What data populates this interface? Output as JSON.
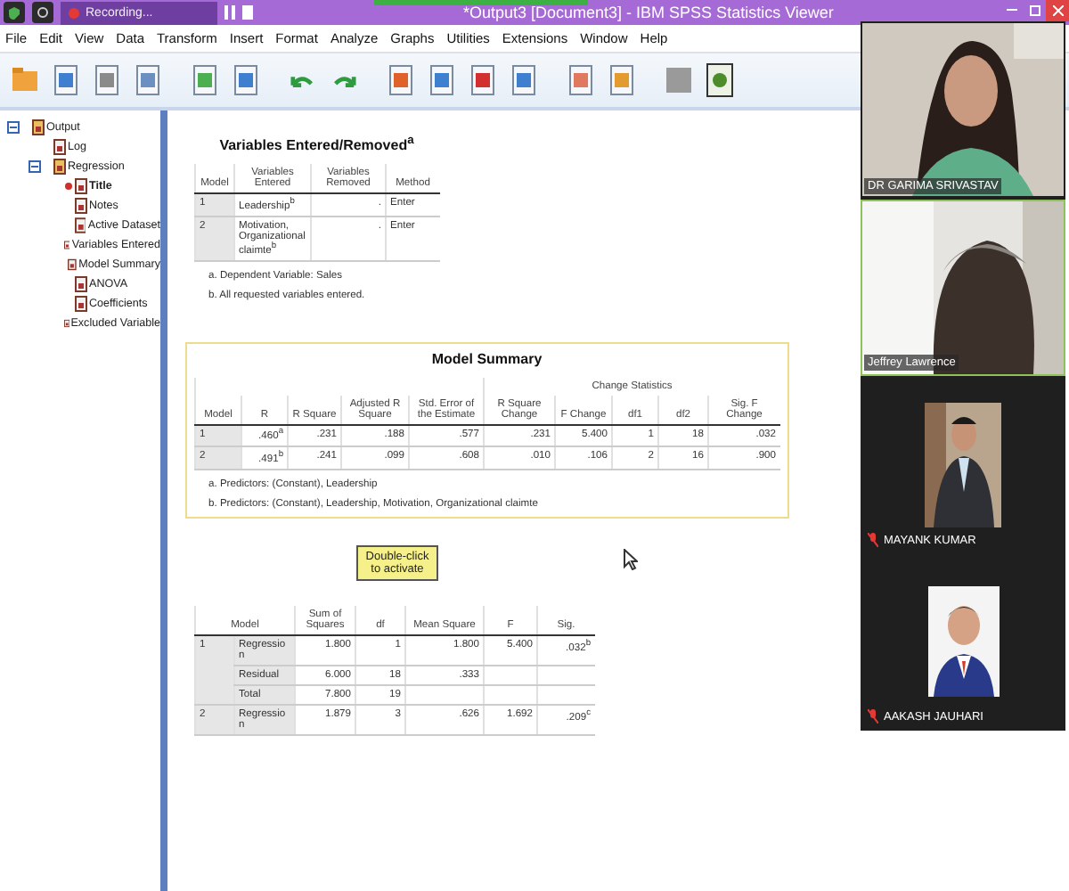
{
  "top_bar": {
    "recording_label": "Recording...",
    "title": "*Output3 [Document3] - IBM SPSS Statistics Viewer"
  },
  "menu": [
    {
      "label": "File"
    },
    {
      "label": "Edit"
    },
    {
      "label": "View"
    },
    {
      "label": "Data"
    },
    {
      "label": "Transform"
    },
    {
      "label": "Insert"
    },
    {
      "label": "Format"
    },
    {
      "label": "Analyze"
    },
    {
      "label": "Graphs"
    },
    {
      "label": "Utilities"
    },
    {
      "label": "Extensions"
    },
    {
      "label": "Window"
    },
    {
      "label": "Help"
    }
  ],
  "tree": [
    {
      "label": "Output",
      "selected": false,
      "expanded": true,
      "children": [
        {
          "label": "Log",
          "selected": false
        },
        {
          "label": "Regression",
          "selected": false,
          "expanded": true,
          "children": [
            {
              "label": "Title",
              "selected": true
            },
            {
              "label": "Notes",
              "selected": false
            },
            {
              "label": "Active Dataset",
              "selected": false
            },
            {
              "label": "Variables Entered",
              "selected": false
            },
            {
              "label": "Model Summary",
              "selected": false
            },
            {
              "label": "ANOVA",
              "selected": false
            },
            {
              "label": "Coefficients",
              "selected": false
            },
            {
              "label": "Excluded Variable",
              "selected": false
            }
          ]
        }
      ]
    }
  ],
  "variables_table": {
    "title": "Variables Entered/Removed$^{a}$",
    "columns": [
      "Model",
      "Variables Entered",
      "Variables Removed",
      "Method"
    ],
    "rows": [
      [
        "1",
        "Leadership$^{b}$",
        ".",
        "Enter"
      ],
      [
        "2",
        "Motivation, Organizational claimte$^{b}$",
        ".",
        "Enter"
      ]
    ],
    "footnotes": [
      "a. Dependent Variable: Sales",
      "b. All requested variables entered."
    ]
  },
  "model_summary": {
    "title": "Model Summary",
    "active": true,
    "group_header": "Change Statistics",
    "columns": [
      "Model",
      "R",
      "R Square",
      "Adjusted R Square",
      "Std. Error of the Estimate",
      "R Square Change",
      "F Change",
      "df1",
      "df2",
      "Sig. F Change"
    ],
    "rows": [
      [
        "1",
        ".460$^{a}$",
        ".231",
        ".188",
        ".577",
        ".231",
        "5.400",
        "1",
        "18",
        ".032"
      ],
      [
        "2",
        ".491$^{b}$",
        ".241",
        ".099",
        ".608",
        ".010",
        ".106",
        "2",
        "16",
        ".900"
      ]
    ],
    "footnotes": [
      "a. Predictors: (Constant), Leadership",
      "b. Predictors: (Constant), Leadership, Motivation, Organizational claimte"
    ]
  },
  "anova": {
    "tooltip": "Double-click to activate",
    "columns": [
      "Model",
      "Sum of Squares",
      "df",
      "Mean Square",
      "F",
      "Sig."
    ],
    "groups": [
      {
        "model": "1",
        "rows": [
          {
            "label": "Regression",
            "cells": [
              "1.800",
              "1",
              "1.800",
              "5.400",
              ".032$^{b}$"
            ]
          },
          {
            "label": "Residual",
            "cells": [
              "6.000",
              "18",
              ".333"
            ]
          },
          {
            "label": "Total",
            "cells": [
              "7.800",
              "19"
            ]
          }
        ]
      },
      {
        "model": "2",
        "rows": [
          {
            "label": "Regression",
            "cells": [
              "1.879",
              "3",
              ".626",
              "1.692",
              ".209$^{c}$"
            ]
          }
        ]
      }
    ]
  },
  "participants": [
    {
      "name": "DR GARIMA SRIVASTAV",
      "kind": "video",
      "speaking": false,
      "muted": false
    },
    {
      "name": "Jeffrey Lawrence",
      "kind": "video",
      "speaking": true,
      "muted": false
    },
    {
      "name": "MAYANK KUMAR",
      "speaking": false,
      "muted": true
    },
    {
      "name": "AAKASH JAUHARI",
      "speaking": false,
      "muted": true
    }
  ]
}
